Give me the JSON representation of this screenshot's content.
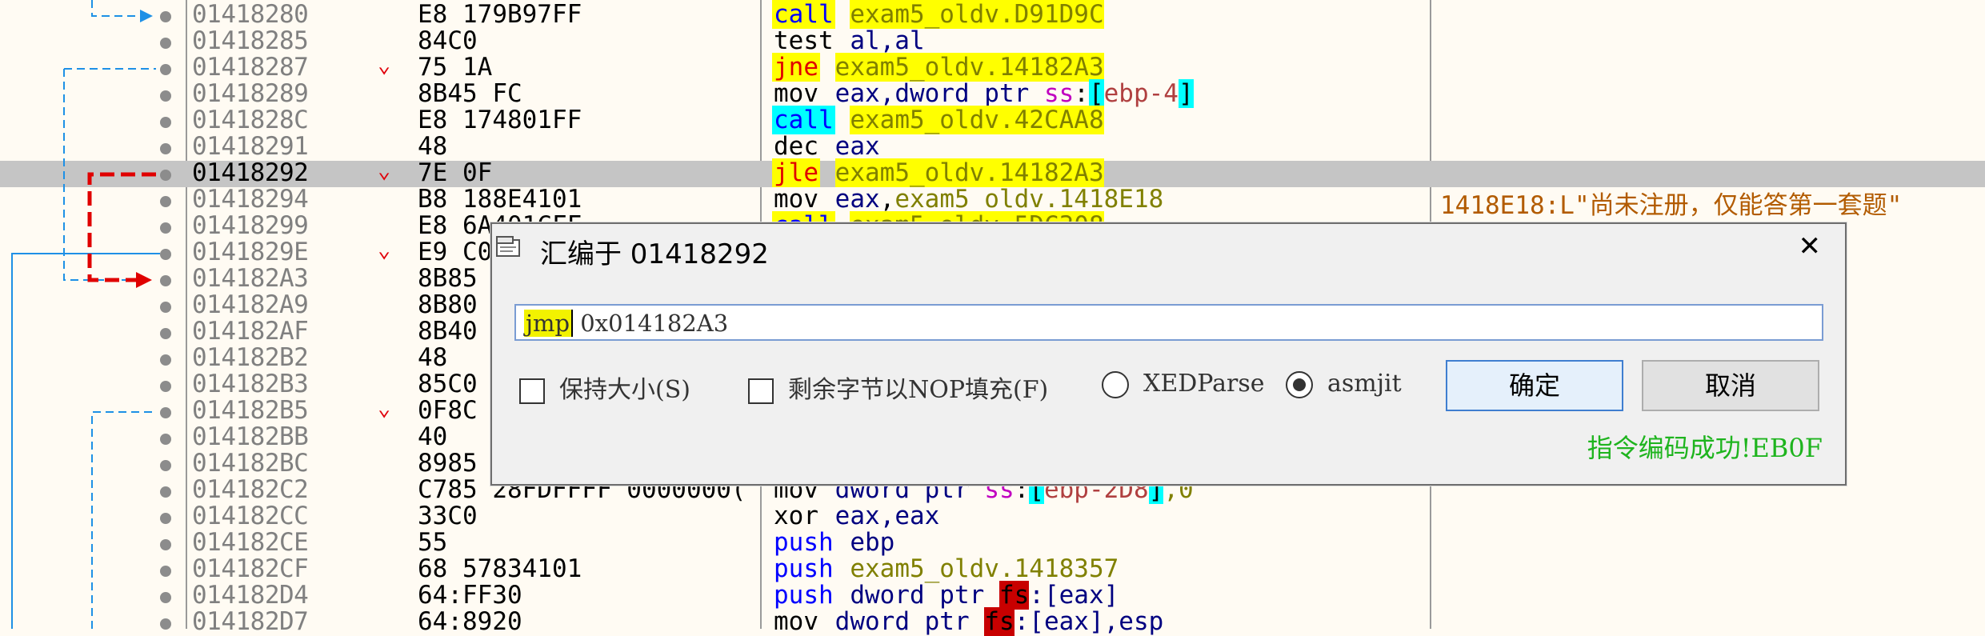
{
  "disasm": {
    "rows": [
      {
        "addr": "01418280",
        "bytes": "E8 179B97FF",
        "mn": "call",
        "mnClass": "c-blue hl",
        "ops": [
          {
            "t": " "
          },
          {
            "t": "exam5_oldv.D91D9C",
            "c": "c-olive hl"
          }
        ],
        "jarrow": ""
      },
      {
        "addr": "01418285",
        "bytes": "84C0",
        "mn": "test",
        "mnClass": "c-dk",
        "ops": [
          {
            "t": " al,al",
            "c": "c-navy"
          }
        ],
        "jarrow": ""
      },
      {
        "addr": "01418287",
        "bytes": "75 1A",
        "mn": "jne",
        "mnClass": "c-red hl",
        "ops": [
          {
            "t": " "
          },
          {
            "t": "exam5_oldv.14182A3",
            "c": "c-olive hl"
          }
        ],
        "jarrow": "⌄"
      },
      {
        "addr": "01418289",
        "bytes": "8B45 FC",
        "mn": "mov",
        "mnClass": "c-dk",
        "ops": [
          {
            "t": " eax",
            "c": "c-navy"
          },
          {
            "t": ",dword ptr ",
            "c": "c-navy"
          },
          {
            "t": "ss",
            "c": "c-mag"
          },
          {
            "t": ":"
          },
          {
            "t": "[",
            "c": "hlc"
          },
          {
            "t": "ebp-4",
            "c": "c-brick"
          },
          {
            "t": "]",
            "c": "hlc"
          }
        ],
        "jarrow": ""
      },
      {
        "addr": "0141828C",
        "bytes": "E8 174801FF",
        "mn": "call",
        "mnClass": "c-blue hlc",
        "ops": [
          {
            "t": " "
          },
          {
            "t": "exam5_oldv.42CAA8",
            "c": "c-olive hl"
          }
        ],
        "jarrow": ""
      },
      {
        "addr": "01418291",
        "bytes": "48",
        "mn": "dec",
        "mnClass": "c-dk",
        "ops": [
          {
            "t": " eax",
            "c": "c-navy"
          }
        ],
        "jarrow": ""
      },
      {
        "addr": "01418292",
        "bytes": "7E 0F",
        "mn": "jle",
        "mnClass": "c-red hl",
        "ops": [
          {
            "t": " "
          },
          {
            "t": "exam5_oldv.14182A3",
            "c": "c-olive hl"
          }
        ],
        "jarrow": "⌄",
        "sel": true
      },
      {
        "addr": "01418294",
        "bytes": "B8 188E4101",
        "mn": "mov",
        "mnClass": "c-dk",
        "ops": [
          {
            "t": " eax",
            "c": "c-navy"
          },
          {
            "t": ","
          },
          {
            "t": "exam5_oldv.1418E18",
            "c": "c-olive"
          }
        ],
        "jarrow": "",
        "comment": "1418E18:L\"尚未注册，仅能答第一套题\""
      },
      {
        "addr": "01418299",
        "bytes": "E8 6A401CFF",
        "mn": "call",
        "mnClass": "c-blue hl",
        "ops": [
          {
            "t": " "
          },
          {
            "t": "exam5_oldv.5DC308",
            "c": "c-olive hl"
          }
        ],
        "jarrow": ""
      },
      {
        "addr": "0141829E",
        "bytes": "E9 C0",
        "mn": "",
        "mnClass": "",
        "ops": [],
        "jarrow": "⌄"
      },
      {
        "addr": "014182A3",
        "bytes": "8B85",
        "mn": "",
        "mnClass": "",
        "ops": [],
        "jarrow": ""
      },
      {
        "addr": "014182A9",
        "bytes": "8B80",
        "mn": "",
        "mnClass": "",
        "ops": [],
        "jarrow": ""
      },
      {
        "addr": "014182AF",
        "bytes": "8B40",
        "mn": "",
        "mnClass": "",
        "ops": [],
        "jarrow": ""
      },
      {
        "addr": "014182B2",
        "bytes": "48",
        "mn": "",
        "mnClass": "",
        "ops": [],
        "jarrow": ""
      },
      {
        "addr": "014182B3",
        "bytes": "85C0",
        "mn": "",
        "mnClass": "",
        "ops": [],
        "jarrow": ""
      },
      {
        "addr": "014182B5",
        "bytes": "0F8C",
        "mn": "",
        "mnClass": "",
        "ops": [],
        "jarrow": "⌄"
      },
      {
        "addr": "014182BB",
        "bytes": "40",
        "mn": "",
        "mnClass": "",
        "ops": [],
        "jarrow": ""
      },
      {
        "addr": "014182BC",
        "bytes": "8985",
        "mn": "",
        "mnClass": "",
        "ops": [],
        "jarrow": ""
      },
      {
        "addr": "014182C2",
        "bytes": "C785 28FDFFFF 0000000(",
        "mn": "mov",
        "mnClass": "c-dk",
        "ops": [
          {
            "t": " dword ptr ",
            "c": "c-navy"
          },
          {
            "t": "ss",
            "c": "c-mag"
          },
          {
            "t": ":"
          },
          {
            "t": "[",
            "c": "hlc"
          },
          {
            "t": "ebp-2D8",
            "c": "c-brick"
          },
          {
            "t": "]",
            "c": "hlc"
          },
          {
            "t": ",0",
            "c": "c-olive"
          }
        ],
        "jarrow": ""
      },
      {
        "addr": "014182CC",
        "bytes": "33C0",
        "mn": "xor",
        "mnClass": "c-dk",
        "ops": [
          {
            "t": " eax,eax",
            "c": "c-navy"
          }
        ],
        "jarrow": ""
      },
      {
        "addr": "014182CE",
        "bytes": "55",
        "mn": "push",
        "mnClass": "c-blue",
        "ops": [
          {
            "t": " ebp",
            "c": "c-navy"
          }
        ],
        "jarrow": ""
      },
      {
        "addr": "014182CF",
        "bytes": "68 57834101",
        "mn": "push",
        "mnClass": "c-blue",
        "ops": [
          {
            "t": " "
          },
          {
            "t": "exam5_oldv.1418357",
            "c": "c-olive"
          }
        ],
        "jarrow": ""
      },
      {
        "addr": "014182D4",
        "bytes": "64:FF30",
        "mn": "push",
        "mnClass": "c-blue",
        "ops": [
          {
            "t": " dword ptr ",
            "c": "c-navy"
          },
          {
            "t": "fs",
            "c": "hlr"
          },
          {
            "t": ":[eax]",
            "c": "c-navy"
          }
        ],
        "jarrow": ""
      },
      {
        "addr": "014182D7",
        "bytes": "64:8920",
        "mn": "mov",
        "mnClass": "c-dk",
        "ops": [
          {
            "t": " dword ptr ",
            "c": "c-navy"
          },
          {
            "t": "fs",
            "c": "hlr"
          },
          {
            "t": ":[eax],esp",
            "c": "c-navy"
          }
        ],
        "jarrow": ""
      }
    ]
  },
  "dialog": {
    "title": "汇编于 01418292",
    "close_label": "✕",
    "input_highlight": "jmp",
    "input_rest": " 0x014182A3",
    "keep_size_label": "保持大小(S)",
    "nop_fill_label": "剩余字节以NOP填充(F)",
    "xedparse_label": "XEDParse",
    "asmjit_label": "asmjit",
    "ok_label": "确定",
    "cancel_label": "取消",
    "status": "指令编码成功!EB0F"
  }
}
